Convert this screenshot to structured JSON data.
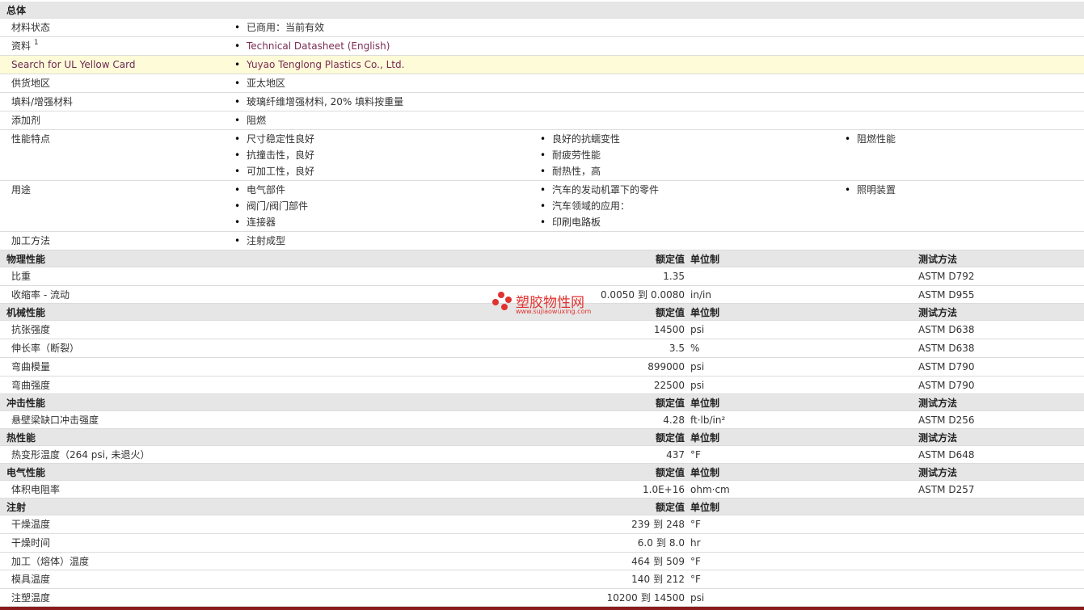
{
  "general": {
    "section": "总体",
    "status_label": "材料状态",
    "status_value": "已商用：当前有效",
    "docs_label": "资料",
    "docs_sup": "1",
    "docs_link": "Technical Datasheet (English)",
    "ul_label": "Search for UL Yellow Card",
    "ul_link": "Yuyao Tenglong Plastics Co., Ltd.",
    "region_label": "供货地区",
    "region_value": "亚太地区",
    "filler_label": "填料/增强材料",
    "filler_value": "玻璃纤维增强材料, 20% 填料按重量",
    "additive_label": "添加剂",
    "additive_value": "阻燃",
    "features_label": "性能特点",
    "features": [
      "尺寸稳定性良好",
      "良好的抗蠕变性",
      "阻燃性能",
      "抗撞击性，良好",
      "耐疲劳性能",
      "可加工性，良好",
      "耐热性，高"
    ],
    "uses_label": "用途",
    "uses": [
      "电气部件",
      "汽车的发动机罩下的零件",
      "照明装置",
      "阀门/阀门部件",
      "汽车领域的应用：",
      "连接器",
      "印刷电路板"
    ],
    "process_label": "加工方法",
    "process_value": "注射成型"
  },
  "headers": {
    "value": "额定值",
    "unit": "单位制",
    "test": "测试方法",
    "to": "到"
  },
  "physical": {
    "section": "物理性能",
    "rows": [
      {
        "name": "比重",
        "value": "1.35",
        "unit": "",
        "test": "ASTM D792"
      },
      {
        "name": "收缩率  - 流动",
        "value_from": "0.0050",
        "value_to": "0.0080",
        "unit": "in/in",
        "test": "ASTM D955"
      }
    ]
  },
  "mechanical": {
    "section": "机械性能",
    "rows": [
      {
        "name": "抗张强度",
        "value": "14500",
        "unit": "psi",
        "test": "ASTM D638"
      },
      {
        "name": "伸长率（断裂）",
        "value": "3.5",
        "unit": "%",
        "test": "ASTM D638"
      },
      {
        "name": "弯曲模量",
        "value": "899000",
        "unit": "psi",
        "test": "ASTM D790"
      },
      {
        "name": "弯曲强度",
        "value": "22500",
        "unit": "psi",
        "test": "ASTM D790"
      }
    ]
  },
  "impact": {
    "section": "冲击性能",
    "rows": [
      {
        "name": "悬壁梁缺口冲击强度",
        "value": "4.28",
        "unit": "ft·lb/in²",
        "test": "ASTM D256"
      }
    ]
  },
  "thermal": {
    "section": "热性能",
    "rows": [
      {
        "name": "热变形温度（264 psi, 未退火）",
        "value": "437",
        "unit": "°F",
        "test": "ASTM D648"
      }
    ]
  },
  "electrical": {
    "section": "电气性能",
    "rows": [
      {
        "name": "体积电阻率",
        "value": "1.0E+16",
        "unit": "ohm·cm",
        "test": "ASTM D257"
      }
    ]
  },
  "injection": {
    "section": "注射",
    "rows": [
      {
        "name": "干燥温度",
        "from": "239",
        "to": "248",
        "unit": "°F"
      },
      {
        "name": "干燥时间",
        "from": "6.0",
        "to": "8.0",
        "unit": "hr"
      },
      {
        "name": "加工（熔体）温度",
        "from": "464",
        "to": "509",
        "unit": "°F"
      },
      {
        "name": "模具温度",
        "from": "140",
        "to": "212",
        "unit": "°F"
      },
      {
        "name": "注塑温度",
        "from": "10200",
        "to": "14500",
        "unit": "psi"
      }
    ]
  },
  "watermark": {
    "title": "塑胶物性网",
    "url": "www.sujiaowuxing.com"
  },
  "colors": {
    "section_bg": "#e6e6e6",
    "highlight_bg": "#fdfbd8",
    "link": "#7a2c55",
    "logo": "#e0322f"
  }
}
